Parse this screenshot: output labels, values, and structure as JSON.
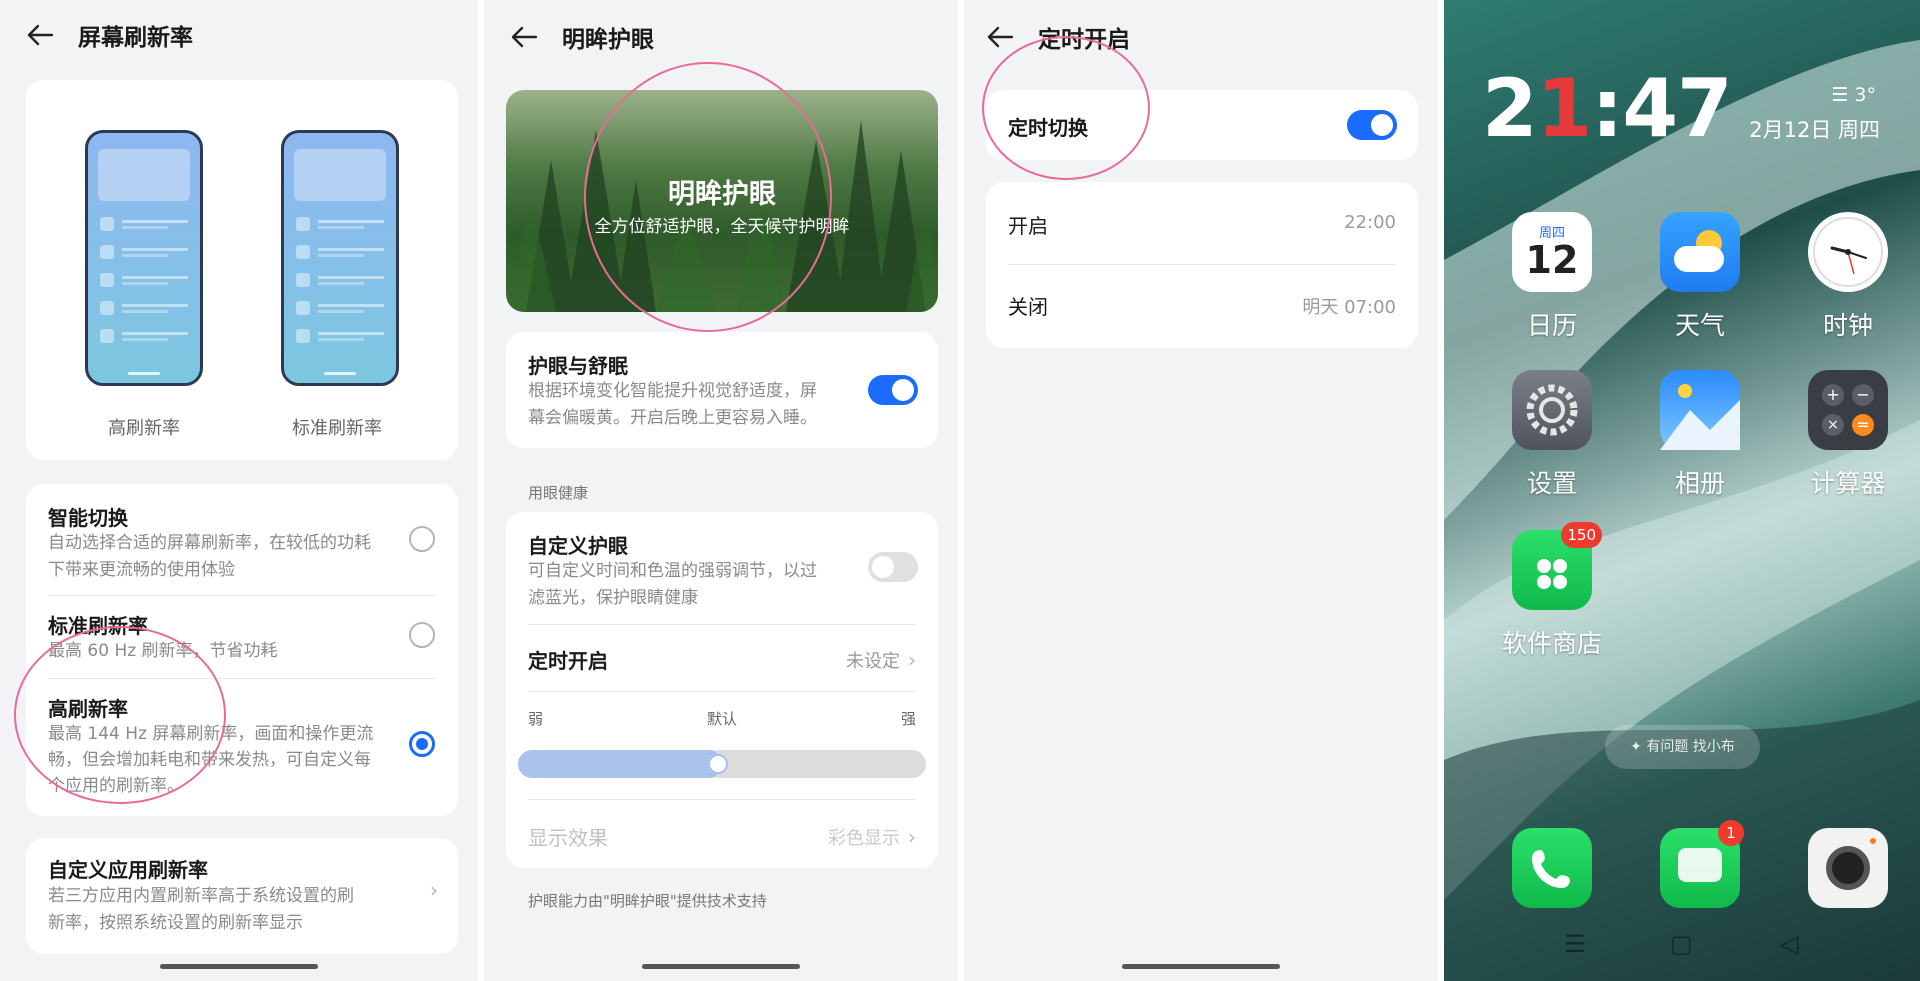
{
  "panel1": {
    "title": "屏幕刷新率",
    "preview": {
      "high_label": "高刷新率",
      "standard_label": "标准刷新率"
    },
    "options": [
      {
        "title": "智能切换",
        "desc1": "自动选择合适的屏幕刷新率，在较低的功耗",
        "desc2": "下带来更流畅的使用体验",
        "selected": false
      },
      {
        "title": "标准刷新率",
        "desc1": "最高 60 Hz 刷新率，节省功耗",
        "selected": false
      },
      {
        "title": "高刷新率",
        "desc1": "最高 144 Hz 屏幕刷新率，画面和操作更流",
        "desc2": "畅，但会增加耗电和带来发热，可自定义每",
        "desc3": "个应用的刷新率。",
        "selected": true
      }
    ],
    "custom": {
      "title": "自定义应用刷新率",
      "desc1": "若三方应用内置刷新率高于系统设置的刷",
      "desc2": "新率，按照系统设置的刷新率显示"
    }
  },
  "panel2": {
    "title": "明眸护眼",
    "banner": {
      "title": "明眸护眼",
      "subtitle": "全方位舒适护眼，全天候守护明眸"
    },
    "eye_comfort": {
      "title": "护眼与舒眠",
      "desc1": "根据环境变化智能提升视觉舒适度，屏",
      "desc2": "幕会偏暖黄。开启后晚上更容易入睡。",
      "on": true
    },
    "section_label": "用眼健康",
    "custom_eye": {
      "title": "自定义护眼",
      "desc1": "可自定义时间和色温的强弱调节，以过",
      "desc2": "滤蓝光，保护眼睛健康",
      "on": false
    },
    "schedule": {
      "title": "定时开启",
      "value": "未设定"
    },
    "slider": {
      "weak": "弱",
      "default": "默认",
      "strong": "强",
      "level": 0.5
    },
    "display": {
      "title": "显示效果",
      "value": "彩色显示"
    },
    "footer": "护眼能力由\"明眸护眼\"提供技术支持"
  },
  "panel3": {
    "title": "定时开启",
    "switch": {
      "title": "定时切换",
      "on": true
    },
    "start": {
      "title": "开启",
      "value": "22:00"
    },
    "end": {
      "title": "关闭",
      "value": "明天 07:00"
    }
  },
  "panel4": {
    "clock_a": "2",
    "clock_red": "1",
    "clock_colon": ":",
    "clock_b": "47",
    "weather": "3°",
    "date": "2月12日 周四",
    "calendar_day_label": "周四",
    "calendar_day": "12",
    "apps": [
      {
        "name": "日历"
      },
      {
        "name": "天气"
      },
      {
        "name": "时钟"
      },
      {
        "name": "设置"
      },
      {
        "name": "相册"
      },
      {
        "name": "计算器"
      },
      {
        "name": "软件商店",
        "badge": "150"
      }
    ],
    "assistant": "有问题 找小布",
    "messages_badge": "1"
  },
  "colors": {
    "accent": "#1a6cff",
    "annotation": "#e86a9a"
  }
}
